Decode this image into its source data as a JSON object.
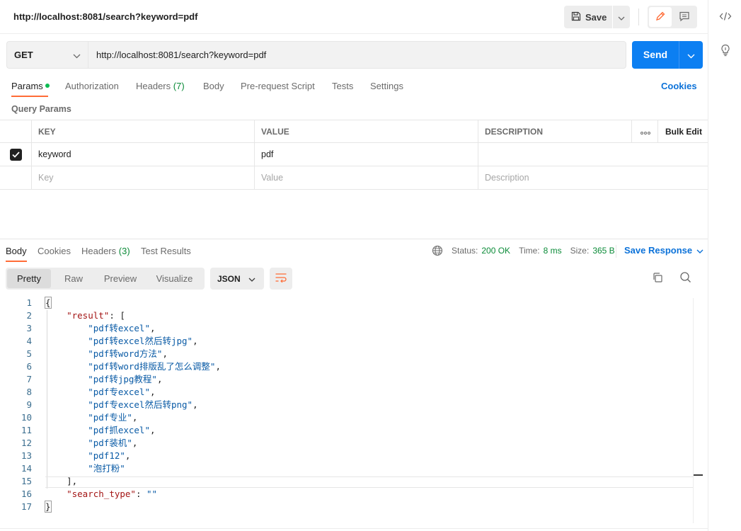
{
  "tab": {
    "title": "http://localhost:8081/search?keyword=pdf"
  },
  "toolbar": {
    "save_label": "Save"
  },
  "request": {
    "method": "GET",
    "url": "http://localhost:8081/search?keyword=pdf",
    "send_label": "Send"
  },
  "request_tabs": [
    {
      "label": "Params"
    },
    {
      "label": "Authorization"
    },
    {
      "label": "Headers",
      "count": "(7)"
    },
    {
      "label": "Body"
    },
    {
      "label": "Pre-request Script"
    },
    {
      "label": "Tests"
    },
    {
      "label": "Settings"
    }
  ],
  "cookies_label": "Cookies",
  "query_params": {
    "title": "Query Params",
    "headers": {
      "key": "KEY",
      "value": "VALUE",
      "description": "DESCRIPTION",
      "bulk_edit": "Bulk Edit"
    },
    "rows": [
      {
        "key": "keyword",
        "value": "pdf",
        "description": "",
        "checked": true
      }
    ],
    "placeholders": {
      "key": "Key",
      "value": "Value",
      "description": "Description"
    }
  },
  "response": {
    "tabs": [
      {
        "label": "Body"
      },
      {
        "label": "Cookies"
      },
      {
        "label": "Headers",
        "count": "(3)"
      },
      {
        "label": "Test Results"
      }
    ],
    "status_label": "Status:",
    "status_value": "200 OK",
    "time_label": "Time:",
    "time_value": "8 ms",
    "size_label": "Size:",
    "size_value": "365 B",
    "save_response_label": "Save Response",
    "view_modes": [
      "Pretty",
      "Raw",
      "Preview",
      "Visualize"
    ],
    "format": "JSON",
    "body_lines": [
      "{",
      "    \"result\": [",
      "        \"pdf转excel\",",
      "        \"pdf转excel然后转jpg\",",
      "        \"pdf转word方法\",",
      "        \"pdf转word排版乱了怎么调整\",",
      "        \"pdf转jpg教程\",",
      "        \"pdf专excel\",",
      "        \"pdf专excel然后转png\",",
      "        \"pdf专业\",",
      "        \"pdf抓excel\",",
      "        \"pdf装机\",",
      "        \"pdf12\",",
      "        \"泡打粉\"",
      "    ],",
      "    \"search_type\": \"\"",
      "}"
    ]
  },
  "colors": {
    "accent": "#ff6c37",
    "primary": "#0c7ff2",
    "success": "#0b8b38",
    "link": "#0c72d9"
  }
}
